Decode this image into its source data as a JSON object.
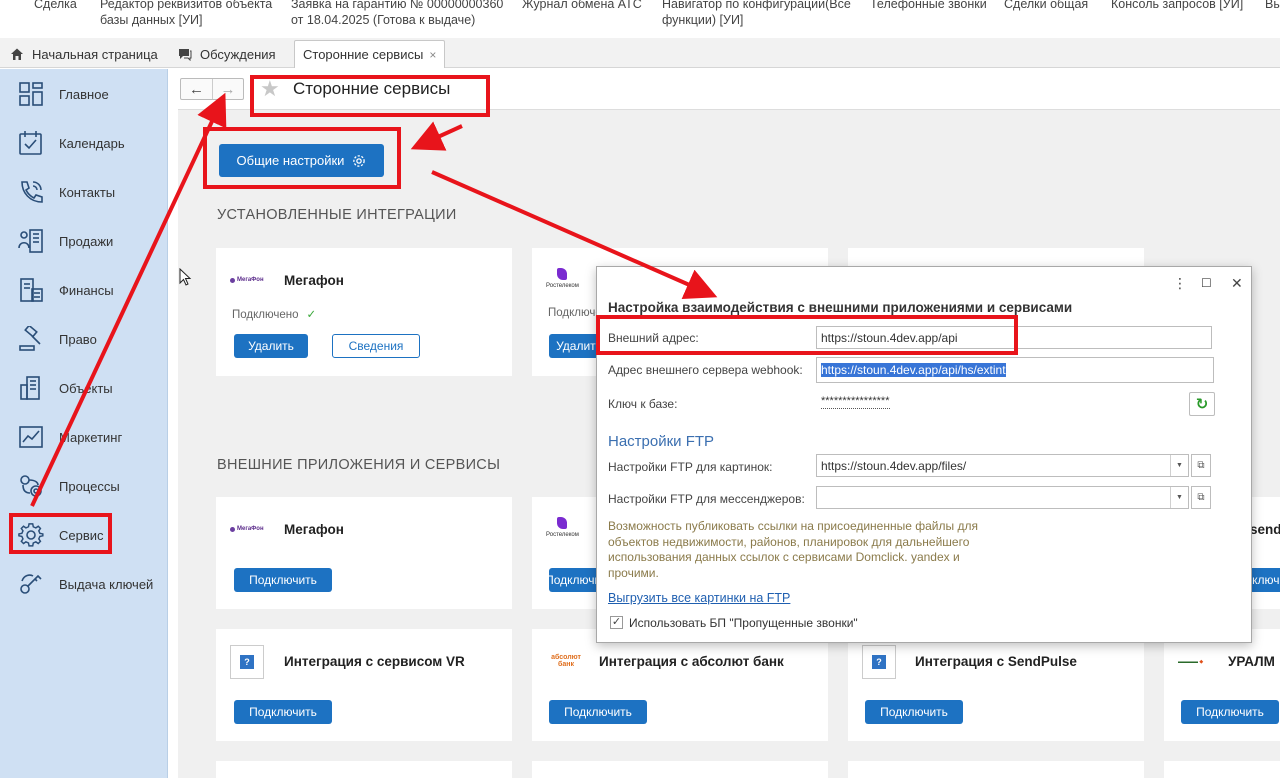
{
  "topmenu": {
    "items": [
      "Сделка",
      "Редактор реквизитов объекта\nбазы данных [УИ]",
      "Заявка на гарантию № 00000000360\nот 18.04.2025 (Готова к выдаче)",
      "Журнал обмена АТС",
      "Навигатор по конфигурации(Все\nфункции) [УИ]",
      "Телефонные звонки",
      "Сделки общая",
      "Консоль запросов [УИ]",
      "Вы"
    ]
  },
  "tabs": [
    {
      "label": "Начальная страница",
      "icon": "home-icon"
    },
    {
      "label": "Обсуждения",
      "icon": "chat-icon"
    },
    {
      "label": "Сторонние сервисы",
      "close": "×"
    }
  ],
  "sidebar": {
    "items": [
      {
        "label": "Главное",
        "icon": "dashboard-icon"
      },
      {
        "label": "Календарь",
        "icon": "calendar-icon"
      },
      {
        "label": "Контакты",
        "icon": "contacts-icon"
      },
      {
        "label": "Продажи",
        "icon": "sales-icon"
      },
      {
        "label": "Финансы",
        "icon": "finance-icon"
      },
      {
        "label": "Право",
        "icon": "law-icon"
      },
      {
        "label": "Объекты",
        "icon": "building-icon"
      },
      {
        "label": "Маркетинг",
        "icon": "chart-icon"
      },
      {
        "label": "Процессы",
        "icon": "process-icon"
      },
      {
        "label": "Сервис",
        "icon": "gear-icon"
      },
      {
        "label": "Выдача ключей",
        "icon": "keys-icon"
      }
    ]
  },
  "page": {
    "title": "Сторонние сервисы",
    "nav_back": "←",
    "nav_forward": "→",
    "star": "★"
  },
  "content": {
    "general_settings_btn": "Общие настройки",
    "installed_title": "УСТАНОВЛЕННЫЕ ИНТЕГРАЦИИ",
    "external_title": "ВНЕШНИЕ ПРИЛОЖЕНИЯ И СЕРВИСЫ",
    "installed_cards": [
      {
        "name": "Мегафон",
        "logo": "МегаФон",
        "status": "Подключено",
        "btn_delete": "Удалить",
        "btn_info": "Сведения"
      },
      {
        "name": "",
        "logo": "Ростелеком",
        "status": "Подключено",
        "btn_delete": "Удалить"
      },
      {
        "name": "",
        "logo": ""
      }
    ],
    "external_cards": [
      {
        "name": "Мегафон",
        "logo": "МегаФон",
        "btn": "Подключить"
      },
      {
        "name": "",
        "logo": "Ростелеком",
        "btn": "Подключить"
      },
      {
        "name": "",
        "logo": ""
      },
      {
        "name": "send",
        "logo": "",
        "btn": "Подключить"
      },
      {
        "name": "Интеграция с сервисом VR",
        "logo": "?",
        "btn": "Подключить"
      },
      {
        "name": "Интеграция с абсолют банк",
        "logo": "абсолют банк",
        "btn": "Подключить"
      },
      {
        "name": "Интеграция с SendPulse",
        "logo": "?",
        "btn": "Подключить"
      },
      {
        "name": "УРАЛМ",
        "logo": "",
        "btn": "Подключить"
      }
    ]
  },
  "dialog": {
    "menu": "⋮",
    "maximize": "☐",
    "close": "✕",
    "title": "Настройка взаимодействия с внешними приложениями и сервисами",
    "ext_address_label": "Внешний адрес:",
    "ext_address_value": "https://stoun.4dev.app/api",
    "webhook_label": "Адрес внешнего сервера webhook:",
    "webhook_value": "https://stoun.4dev.app/api/hs/extint",
    "key_label": "Ключ к базе:",
    "key_value": "****************",
    "refresh": "↻",
    "ftp_header": "Настройки FTP",
    "ftp_images_label": "Настройки FTP для картинок:",
    "ftp_images_value": "https://stoun.4dev.app/files/",
    "ftp_messengers_label": "Настройки FTP для мессенджеров:",
    "ftp_messengers_value": "",
    "note": "Возможность публиковать ссылки на присоединенные файлы для объектов недвижимости, районов, планировок для дальнейшего использования данных ссылок с сервисами Domclick. yandex и прочими.",
    "upload_link": "Выгрузить все картинки на FTP",
    "checkbox_label": "Использовать БП \"Пропущенные звонки\"",
    "checkbox_mark": "✓"
  },
  "colors": {
    "accent": "#1d72c2",
    "sidebar_bg": "#cfe0f3",
    "annotation_red": "#e8141b"
  }
}
